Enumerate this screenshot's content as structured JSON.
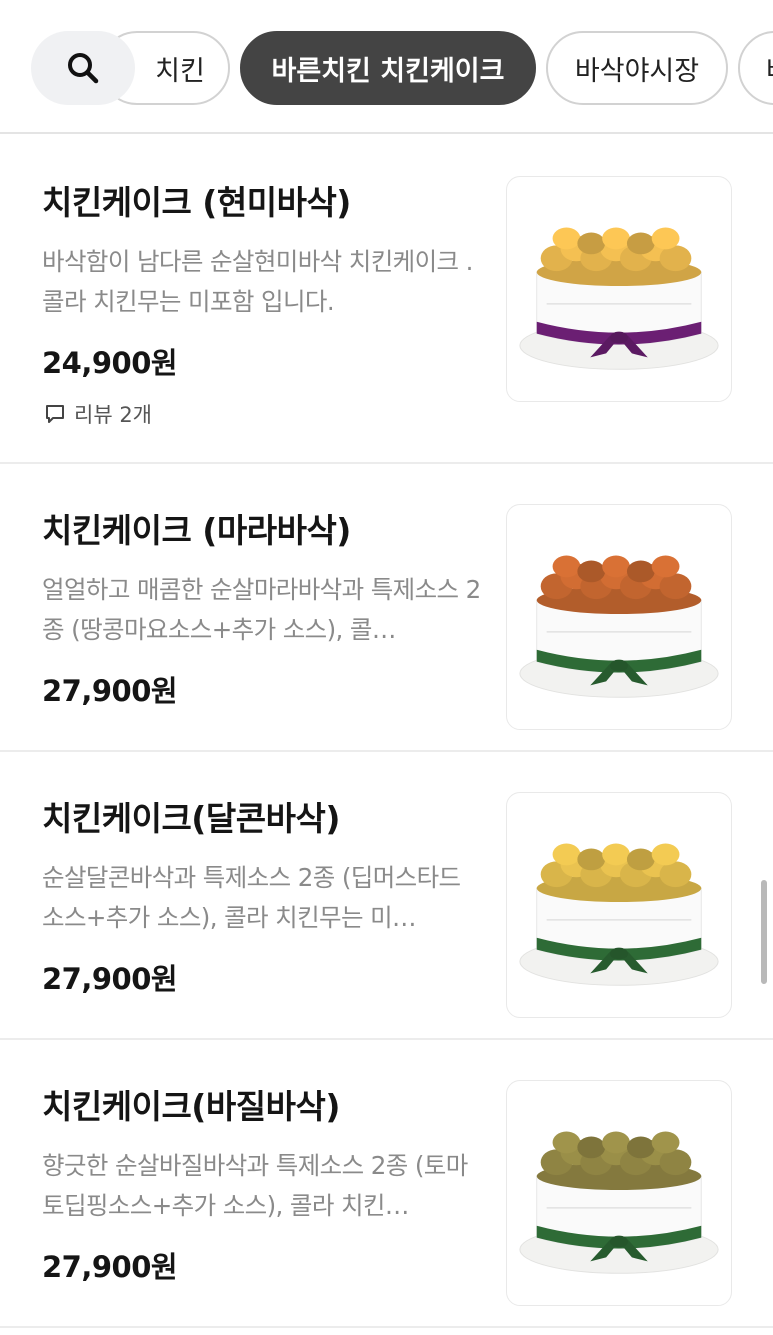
{
  "category_tabs": [
    {
      "label": "치킨",
      "active": false
    },
    {
      "label": "바른치킨  치킨케이크",
      "active": true
    },
    {
      "label": "바삭야시장",
      "active": false
    },
    {
      "label": "바",
      "active": false
    }
  ],
  "menu_items": [
    {
      "name": "치킨케이크 (현미바삭)",
      "description": "바삭함이 남다른 순살현미바삭 치킨케이크 . 콜라 치킨무는 미포함 입니다.",
      "price": "24,900원",
      "review": "리뷰 2개",
      "image": {
        "chicken_color": "#e2b24c",
        "ribbon_color": "#6b1f73"
      }
    },
    {
      "name": "치킨케이크 (마라바삭)",
      "description": "얼얼하고 매콤한 순살마라바삭과 특제소스 2종 (땅콩마요소스+추가 소스), 콜…",
      "price": "27,900원",
      "image": {
        "chicken_color": "#c2652f",
        "ribbon_color": "#2e6b36"
      }
    },
    {
      "name": "치킨케이크(달콘바삭)",
      "description": "순살달콘바삭과 특제소스 2종 (딥머스타드소스+추가 소스), 콜라 치킨무는 미…",
      "price": "27,900원",
      "image": {
        "chicken_color": "#d9b54a",
        "ribbon_color": "#2e6b36"
      }
    },
    {
      "name": "치킨케이크(바질바삭)",
      "description": "향긋한 순살바질바삭과 특제소스 2종 (토마토딥핑소스+추가 소스), 콜라 치킨…",
      "price": "27,900원",
      "image": {
        "chicken_color": "#8f8443",
        "ribbon_color": "#2e6b36"
      }
    }
  ]
}
